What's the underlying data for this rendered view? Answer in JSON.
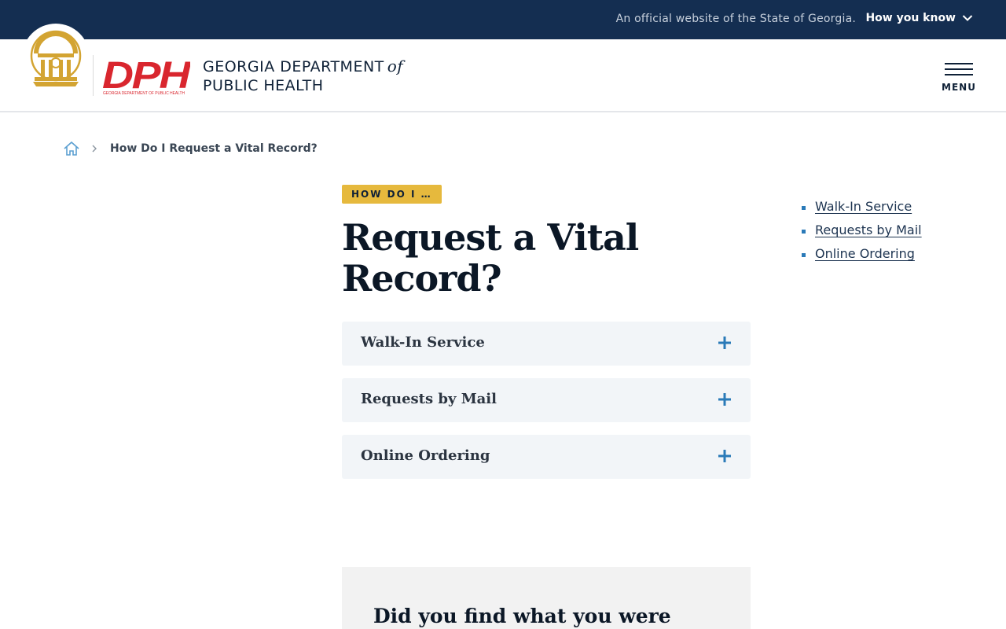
{
  "topbar": {
    "official_text": "An official website of the State of Georgia.",
    "how_you_know": "How you know"
  },
  "header": {
    "org_line1": "GEORGIA DEPARTMENT",
    "org_of": "of",
    "org_line2": "PUBLIC HEALTH",
    "logo_text": "DPH",
    "logo_subtext": "GEORGIA DEPARTMENT OF PUBLIC HEALTH",
    "menu_label": "MENU"
  },
  "breadcrumb": {
    "current": "How Do I Request a Vital Record?"
  },
  "main": {
    "tag": "HOW DO I …",
    "title": "Request a Vital Record?",
    "accordions": [
      {
        "label": "Walk-In Service"
      },
      {
        "label": "Requests by Mail"
      },
      {
        "label": "Online Ordering"
      }
    ],
    "feedback_title": "Did you find what you were"
  },
  "side_nav": {
    "items": [
      {
        "label": "Walk-In Service"
      },
      {
        "label": "Requests by Mail"
      },
      {
        "label": "Online Ordering"
      }
    ]
  },
  "colors": {
    "navy": "#142e51",
    "gold": "#e6b93d",
    "dph_red": "#d9262e",
    "accent_blue": "#2a7ab8",
    "accordion_bg": "#f2f5f8"
  },
  "icons": {
    "chevron": "chevron-down-icon",
    "home": "home-icon",
    "breadcrumb_separator": "chevron-right-icon",
    "expand": "plus-icon",
    "menu": "hamburger-icon"
  }
}
